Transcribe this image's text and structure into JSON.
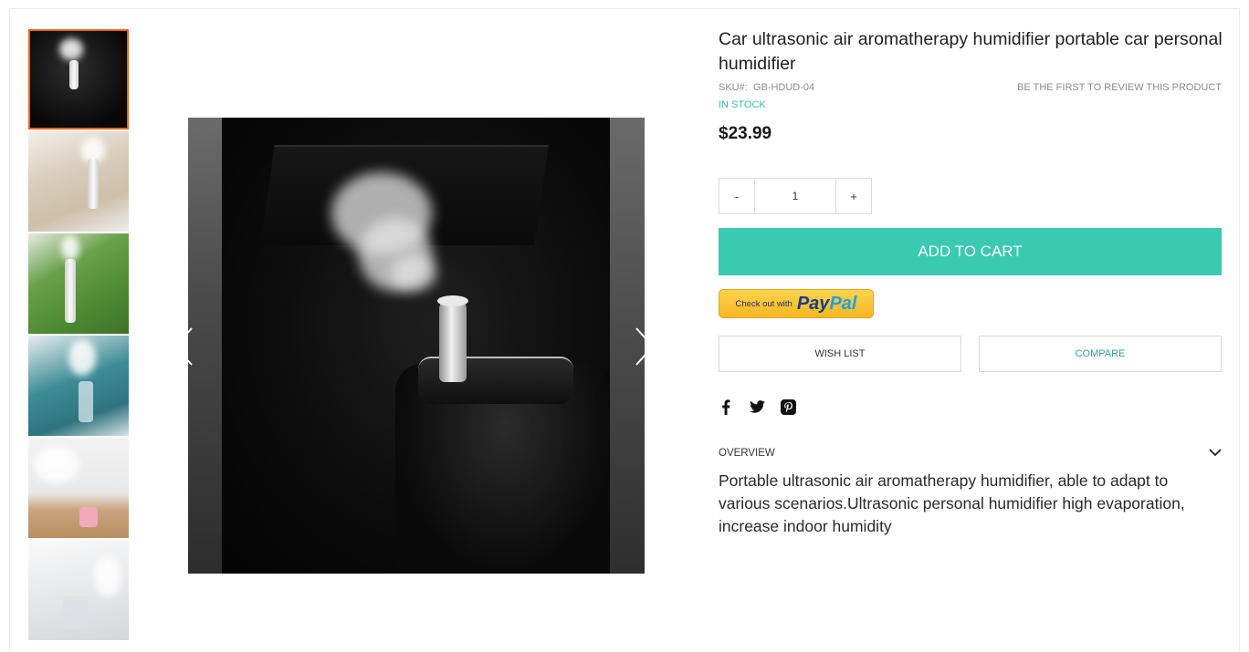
{
  "product": {
    "title": "Car ultrasonic air aromatherapy humidifier portable car personal humidifier",
    "sku_label": "SKU#:",
    "sku_value": "GB-HDUD-04",
    "review_link": "BE THE FIRST TO REVIEW THIS PRODUCT",
    "stock": "IN STOCK",
    "price": "$23.99"
  },
  "quantity": {
    "minus_label": "-",
    "value": "1",
    "plus_label": "+"
  },
  "actions": {
    "add_to_cart": "ADD TO CART",
    "paypal_prefix": "Check out with",
    "paypal_pay": "Pay",
    "paypal_pal": "Pal",
    "wish_list": "WISH LIST",
    "compare": "COMPARE"
  },
  "social": {
    "icons": [
      "facebook-icon",
      "twitter-icon",
      "pinterest-icon"
    ]
  },
  "overview": {
    "label": "OVERVIEW",
    "text": "Portable ultrasonic air aromatherapy humidifier, able to adapt to various scenarios.Ultrasonic personal humidifier high evaporation, increase indoor humidity"
  },
  "gallery": {
    "thumbnail_count": 6,
    "active_index": 0
  },
  "colors": {
    "accent": "#3ac9b1",
    "stock": "#3bc1a7",
    "active_thumb_border": "#e8621b",
    "paypal_yellow": "#ffc43a"
  }
}
